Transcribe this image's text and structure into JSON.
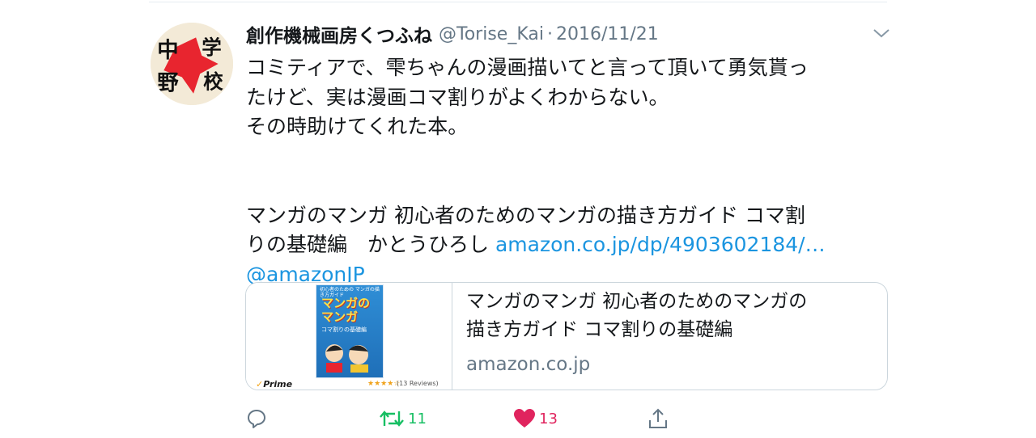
{
  "tweet": {
    "display_name": "創作機械画房くつふね",
    "handle": "@Torise_Kai",
    "separator": "·",
    "date": "2016/11/21",
    "avatar_text": [
      "中",
      "野",
      "学",
      "校"
    ],
    "body": {
      "line1": "コミティアで、雫ちゃんの漫画描いてと言って頂いて勇気貰っ",
      "line2": "たけど、実は漫画コマ割りがよくわからない。",
      "line3": "その時助けてくれた本。",
      "book_line1": "マンガのマンガ 初心者のためのマンガの描き方ガイド コマ割",
      "book_line2": "りの基礎編　かとうひろし ",
      "link": "amazon.co.jp/dp/4903602184/…",
      "mention": "@amazonJP"
    }
  },
  "card": {
    "title_line1": "マンガのマンガ 初心者のためのマンガの",
    "title_line2": "描き方ガイド コマ割りの基礎編",
    "domain": "amazon.co.jp",
    "book_cover_top": "初心者のための マンガの描き方ガイド",
    "book_cover_title_1": "マンガの",
    "book_cover_title_2": "マンガ",
    "book_cover_sub": "コマ割りの基礎編",
    "prime_label": "Prime",
    "stars": "★★★★☆",
    "reviews": "(13 Reviews)"
  },
  "actions": {
    "retweets": "11",
    "likes": "13"
  },
  "colors": {
    "link": "#1b95e0",
    "secondary": "#657786",
    "retweet": "#17bf63",
    "like": "#e0245e"
  },
  "icons": [
    "chevron-down-icon",
    "reply-icon",
    "retweet-icon",
    "heart-icon",
    "share-icon"
  ]
}
